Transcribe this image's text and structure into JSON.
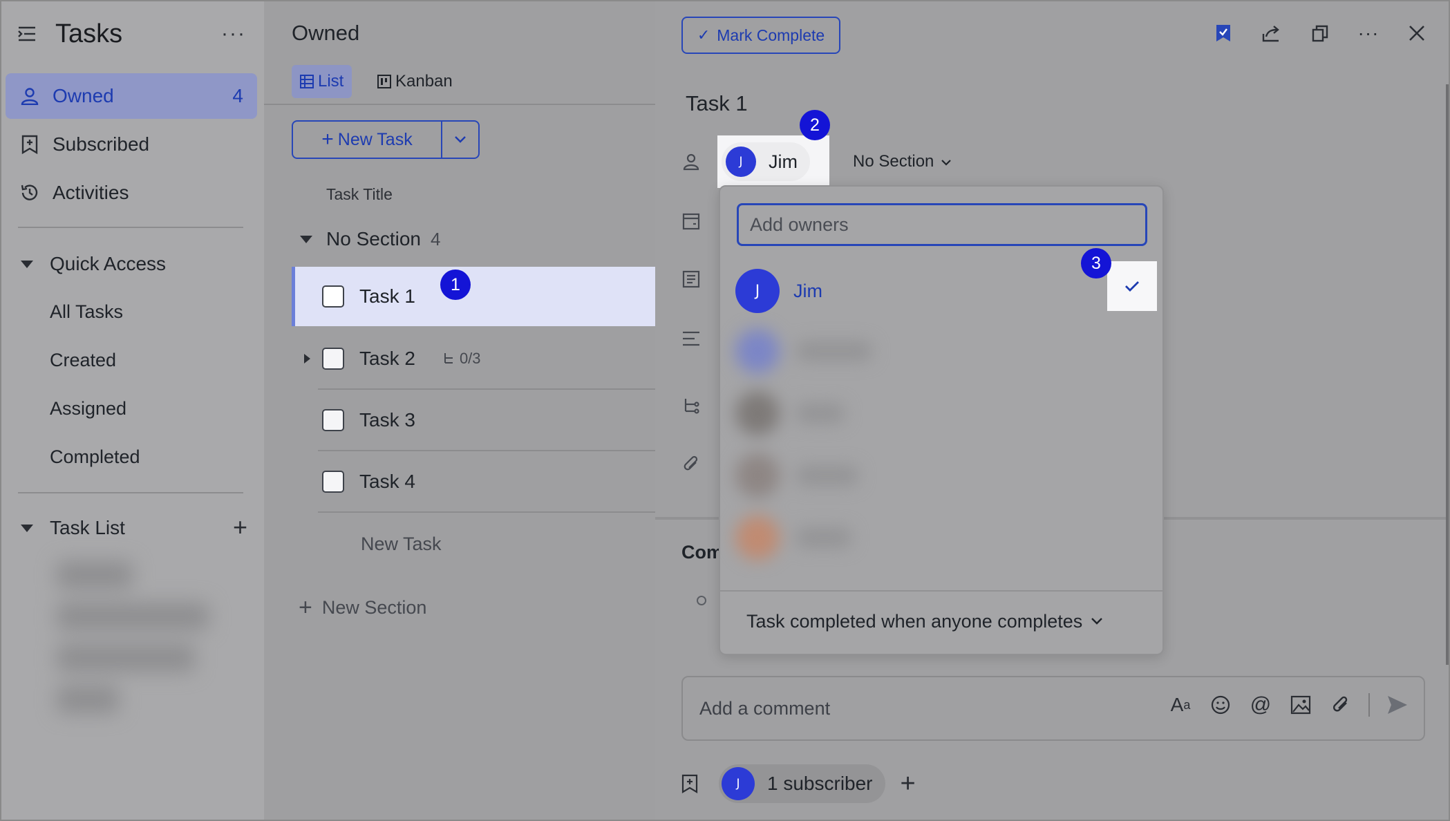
{
  "sidebar": {
    "title": "Tasks",
    "more": "···",
    "nav": [
      {
        "label": "Owned",
        "count": "4",
        "icon": "person-icon"
      },
      {
        "label": "Subscribed",
        "icon": "bookmark-icon"
      },
      {
        "label": "Activities",
        "icon": "history-icon"
      }
    ],
    "quick_access": {
      "label": "Quick Access",
      "items": [
        "All Tasks",
        "Created",
        "Assigned",
        "Completed"
      ]
    },
    "task_list": {
      "label": "Task List",
      "add": "+"
    }
  },
  "middle": {
    "title": "Owned",
    "tabs": [
      {
        "label": "List"
      },
      {
        "label": "Kanban"
      }
    ],
    "new_task_button": "New Task",
    "column_header": "Task Title",
    "section": {
      "name": "No Section",
      "count": "4"
    },
    "tasks": [
      {
        "title": "Task 1"
      },
      {
        "title": "Task 2",
        "subtasks": "0/3"
      },
      {
        "title": "Task 3"
      },
      {
        "title": "Task 4"
      }
    ],
    "new_task_row": "New Task",
    "new_section": "New Section"
  },
  "detail": {
    "mark_complete": "Mark Complete",
    "task_title": "Task 1",
    "owner": {
      "name": "Jim",
      "initial": "J"
    },
    "section_dropdown": "No Section",
    "comments_label": "Com",
    "comment_placeholder": "Add a comment",
    "subscribers": {
      "initial": "J",
      "text": "1 subscriber"
    }
  },
  "popup": {
    "search_placeholder": "Add owners",
    "selected_user": {
      "name": "Jim",
      "initial": "J"
    },
    "footer": "Task completed when anyone completes"
  },
  "badges": {
    "one": "1",
    "two": "2",
    "three": "3"
  },
  "colors": {
    "accent": "#1d3bb0",
    "badge": "#1414d6",
    "avatar": "#2c3bd6"
  }
}
